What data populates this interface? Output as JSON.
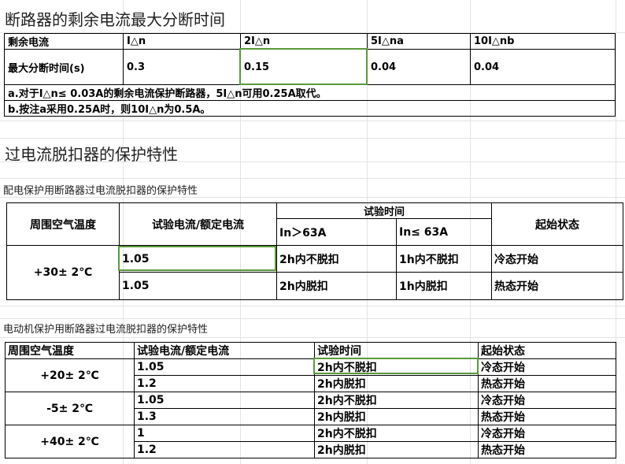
{
  "section1": {
    "title": "断路器的剩余电流最大分断时间",
    "table": {
      "header": [
        "剩余电流",
        "I△n",
        "2I△n",
        "5I△na",
        "10I△nb"
      ],
      "row": [
        "最大分断时间(s)",
        "0.3",
        "0.15",
        "0.04",
        "0.04"
      ],
      "note_a": "a.对于I△n≤  0.03A的剩余电流保护断路器，5I△n可用0.25A取代。",
      "note_b": "b.按注a采用0.25A时，则10I△n为0.5A。"
    }
  },
  "section2": {
    "title": "过电流脱扣器的保护特性",
    "subtitle": "配电保护用断路器过电流脱扣器的保护特性",
    "table": {
      "col_ambient": "周围空气温度",
      "col_current": "试验电流/额定电流",
      "col_time": "试验时间",
      "col_time_sub1": "In＞63A",
      "col_time_sub2": "In≤  63A",
      "col_state": "起始状态",
      "ambient": "+30±  2℃",
      "rows": [
        [
          "1.05",
          "2h内不脱扣",
          "1h内不脱扣",
          "冷态开始"
        ],
        [
          "1.05",
          "2h内脱扣",
          "1h内脱扣",
          "热态开始"
        ]
      ]
    }
  },
  "section3": {
    "subtitle": "电动机保护用断路器过电流脱扣器的保护特性",
    "table": {
      "header": [
        "周围空气温度",
        "试验电流/额定电流",
        "试验时间",
        "起始状态"
      ],
      "groups": [
        {
          "ambient": "+20±  2℃",
          "rows": [
            [
              "1.05",
              "2h内不脱扣",
              "冷态开始"
            ],
            [
              "1.2",
              "2h内脱扣",
              "热态开始"
            ]
          ]
        },
        {
          "ambient": "-5±  2℃",
          "rows": [
            [
              "1.05",
              "2h内不脱扣",
              "冷态开始"
            ],
            [
              "1.3",
              "2h内脱扣",
              "热态开始"
            ]
          ]
        },
        {
          "ambient": "+40±  2℃",
          "rows": [
            [
              "1",
              "2h内不脱扣",
              "冷态开始"
            ],
            [
              "1.2",
              "2h内脱扣",
              "热态开始"
            ]
          ]
        }
      ]
    }
  },
  "colors": {
    "highlight": "#5a9a3a",
    "gridline": "#e3e3e3",
    "border": "#000000"
  }
}
